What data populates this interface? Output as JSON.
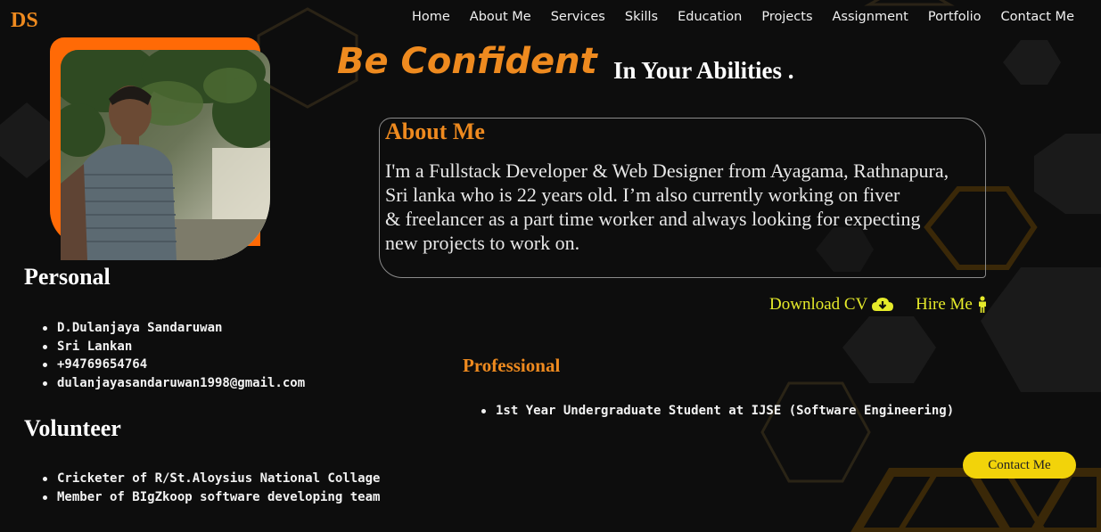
{
  "logo": "DS",
  "nav": [
    "Home",
    "About Me",
    "Services",
    "Skills",
    "Education",
    "Projects",
    "Assignment",
    "Portfolio",
    "Contact Me"
  ],
  "tagline": {
    "highlight": "Be Confident",
    "rest": "In Your Abilities ."
  },
  "about": {
    "title": "About Me",
    "lines": [
      "I'm a Fullstack Developer & Web Designer from Ayagama, Rathnapura,",
      "Sri lanka who is 22 years old. I’m also currently working on fiver",
      "& freelancer as a part time worker and always looking for expecting",
      "new projects to work on."
    ]
  },
  "buttons": {
    "download_cv": "Download CV",
    "download_icon": "cloud-download-icon",
    "hire_me": "Hire Me",
    "hire_icon": "person-icon",
    "contact_me": "Contact Me"
  },
  "personal": {
    "title": "Personal",
    "items": [
      "D.Dulanjaya Sandaruwan",
      "Sri Lankan",
      "+94769654764",
      "dulanjayasandaruwan1998@gmail.com"
    ]
  },
  "volunteer": {
    "title": "Volunteer",
    "items": [
      "Cricketer of R/St.Aloysius National Collage",
      "Member of BIgZkoop software developing team"
    ]
  },
  "professional": {
    "title": "Professional",
    "items": [
      "1st Year Undergraduate Student at IJSE (Software Engineering)"
    ]
  },
  "colors": {
    "accent": "#ee8a1f",
    "frame": "#ff6a06",
    "highlight_text": "#e5ea2a",
    "contact_button": "#f2d30a",
    "background": "#0d0d0d"
  }
}
